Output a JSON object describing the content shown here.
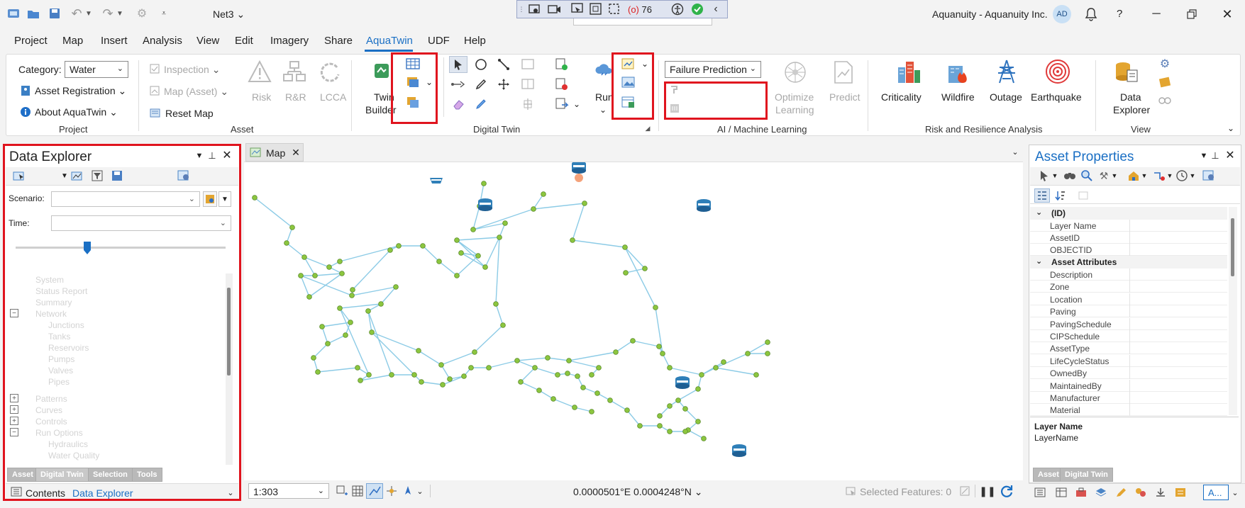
{
  "titlebar": {
    "project_name": "Net3",
    "app_title": "Aquanuity - Aquanuity Inc.",
    "user_initials": "AD",
    "quick_toolbar_count": "76",
    "help_label": "?"
  },
  "menu": {
    "items": [
      "Project",
      "Map",
      "Insert",
      "Analysis",
      "View",
      "Edit",
      "Imagery",
      "Share",
      "AquaTwin",
      "UDF",
      "Help"
    ]
  },
  "ribbon": {
    "project": {
      "category_label": "Category:",
      "category_value": "Water",
      "asset_registration": "Asset Registration",
      "about_aquatwin": "About AquaTwin",
      "group_label": "Project"
    },
    "asset": {
      "inspection": "Inspection",
      "map_asset": "Map (Asset)",
      "reset_map": "Reset Map",
      "risk": "Risk",
      "rr": "R&R",
      "lcca": "LCCA",
      "group_label": "Asset"
    },
    "digital_twin": {
      "twin_builder_line1": "Twin",
      "twin_builder_line2": "Builder",
      "run": "Run",
      "group_label": "Digital Twin"
    },
    "ai": {
      "model_value": "Failure Prediction",
      "optimize_line1": "Optimize",
      "optimize_line2": "Learning",
      "predict": "Predict",
      "group_label": "AI / Machine Learning"
    },
    "risk": {
      "criticality": "Criticality",
      "wildfire": "Wildfire",
      "outage": "Outage",
      "earthquake": "Earthquake",
      "group_label": "Risk and Resilience Analysis"
    },
    "view": {
      "data_explorer_line1": "Data",
      "data_explorer_line2": "Explorer",
      "group_label": "View"
    }
  },
  "data_explorer": {
    "title": "Data Explorer",
    "scenario_label": "Scenario:",
    "time_label": "Time:",
    "tabs": [
      "Asset",
      "Digital Twin",
      "Selection",
      "Tools"
    ],
    "bottom_tabs": [
      "Contents",
      "Data Explorer"
    ],
    "slider_fraction": 0.34
  },
  "map": {
    "tab_label": "Map",
    "scale": "1:303",
    "coordinates": "0.0000501°E 0.0004248°N",
    "selected_features": "Selected Features: 0"
  },
  "asset_properties": {
    "title": "Asset Properties",
    "section_id": "(ID)",
    "id_fields": [
      "Layer Name",
      "AssetID",
      "OBJECTID"
    ],
    "section_attributes": "Asset Attributes",
    "attribute_fields": [
      "Description",
      "Zone",
      "Location",
      "Paving",
      "PavingSchedule",
      "CIPSchedule",
      "AssetType",
      "LifeCycleStatus",
      "OwnedBy",
      "MaintainedBy",
      "Manufacturer",
      "Material"
    ],
    "detail_title": "Layer Name",
    "detail_value": "LayerName",
    "tabs": [
      "Asset",
      "Digital Twin"
    ],
    "bottom_tab": "A..."
  },
  "colors": {
    "accent": "#1a6fc4",
    "highlight_red": "#e0141e",
    "pipe": "#8ccbe6",
    "node": "#8cc63f",
    "tank": "#2f7fb8"
  }
}
